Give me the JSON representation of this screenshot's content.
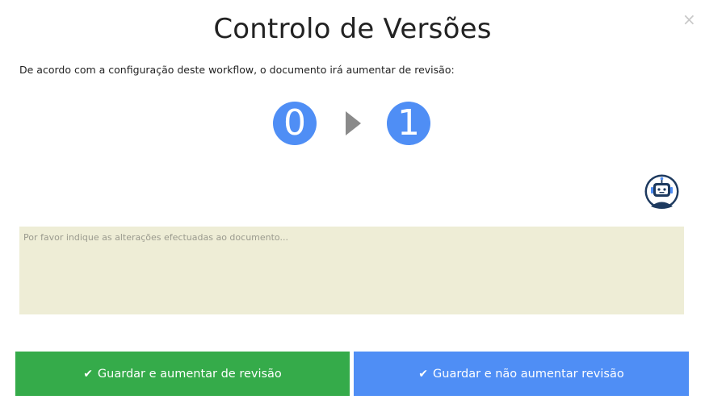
{
  "dialog": {
    "title": "Controlo de Versões",
    "close_glyph": "×",
    "description": "De acordo com a configuração deste workflow, o documento irá aumentar de revisão:"
  },
  "version": {
    "from": "0",
    "to": "1",
    "arrow_icon": "arrow-right-icon"
  },
  "assistant": {
    "icon": "robot-icon"
  },
  "notes": {
    "placeholder": "Por favor indique as alterações efectuadas ao documento...",
    "value": ""
  },
  "actions": {
    "save_increase_label": "Guardar e aumentar de revisão",
    "save_keep_label": "Guardar e não aumentar revisão",
    "check_icon": "check-icon"
  },
  "colors": {
    "accent_blue": "#4f8ef5",
    "success_green": "#35ab4a",
    "notes_background": "#eeedd6"
  }
}
